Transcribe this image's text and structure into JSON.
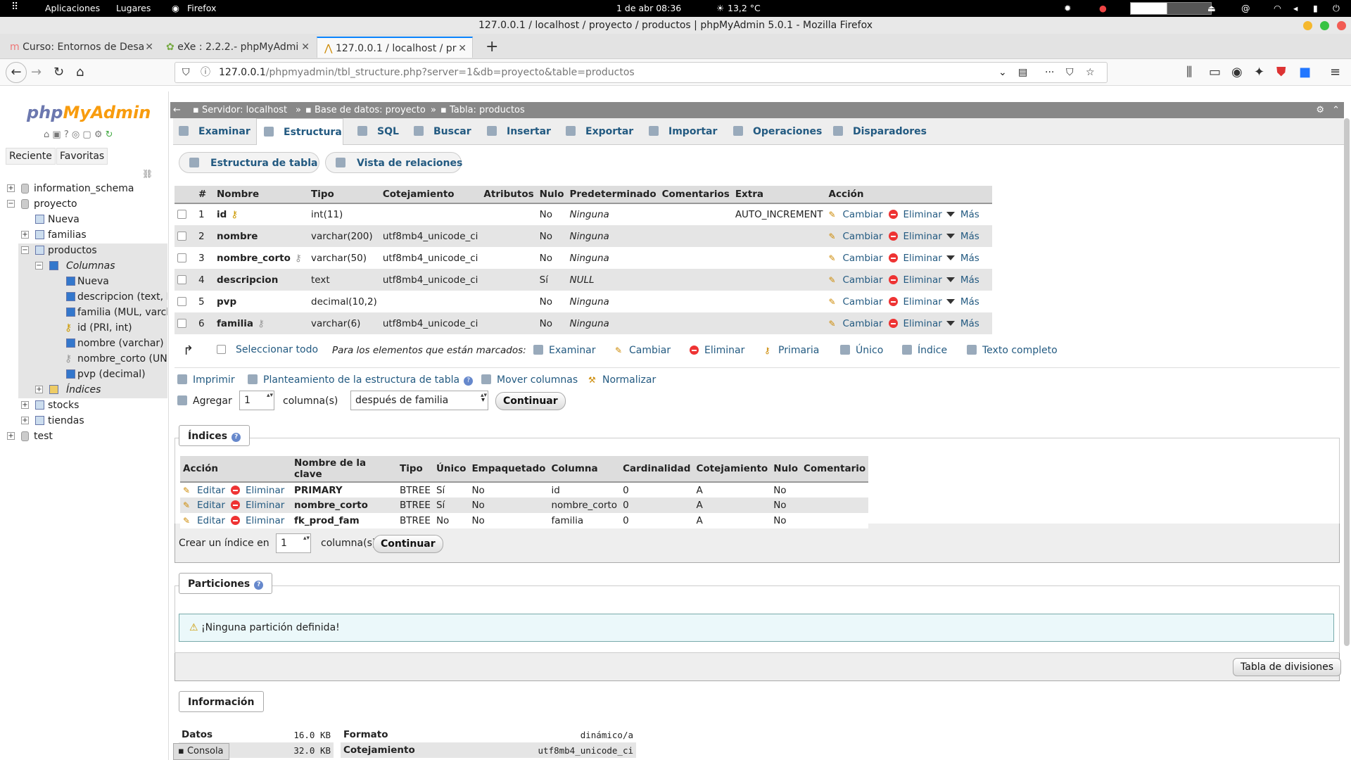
{
  "system": {
    "activities": "Aplicaciones",
    "places": "Lugares",
    "app": "Firefox",
    "clock": "1 de abr  08:36",
    "weather": "13,2 °C"
  },
  "window": {
    "title": "127.0.0.1 / localhost / proyecto / productos | phpMyAdmin 5.0.1 - Mozilla Firefox"
  },
  "browser_tabs": [
    {
      "label": "Curso: Entornos de Desa"
    },
    {
      "label": "eXe : 2.2.2.- phpMyAdmi"
    },
    {
      "label": "127.0.0.1 / localhost / pr"
    }
  ],
  "url": {
    "host": "127.0.0.1",
    "path": "/phpmyadmin/tbl_structure.php?server=1&db=proyecto&table=productos"
  },
  "sidebar": {
    "logo_php": "php",
    "logo_myadmin": "MyAdmin",
    "recent": "Reciente",
    "favorites": "Favoritas",
    "tree": [
      "information_schema",
      "proyecto",
      "Nueva",
      "familias",
      "productos",
      "Columnas",
      "Nueva",
      "descripcion (text, N",
      "familia (MUL, varcha",
      "id (PRI, int)",
      "nombre (varchar)",
      "nombre_corto (UNI,",
      "pvp (decimal)",
      "Índices",
      "stocks",
      "tiendas",
      "test"
    ]
  },
  "breadcrumb": {
    "server": "Servidor: localhost",
    "db": "Base de datos: proyecto",
    "table": "Tabla: productos"
  },
  "main_tabs": [
    "Examinar",
    "Estructura",
    "SQL",
    "Buscar",
    "Insertar",
    "Exportar",
    "Importar",
    "Operaciones",
    "Disparadores"
  ],
  "sub_tabs": [
    "Estructura de tabla",
    "Vista de relaciones"
  ],
  "structure": {
    "headers": [
      "#",
      "Nombre",
      "Tipo",
      "Cotejamiento",
      "Atributos",
      "Nulo",
      "Predeterminado",
      "Comentarios",
      "Extra",
      "Acción"
    ],
    "rows": [
      {
        "n": "1",
        "name": "id",
        "type": "int(11)",
        "coll": "",
        "attr": "",
        "null": "No",
        "def": "Ninguna",
        "comm": "",
        "extra": "AUTO_INCREMENT"
      },
      {
        "n": "2",
        "name": "nombre",
        "type": "varchar(200)",
        "coll": "utf8mb4_unicode_ci",
        "attr": "",
        "null": "No",
        "def": "Ninguna",
        "comm": "",
        "extra": ""
      },
      {
        "n": "3",
        "name": "nombre_corto",
        "type": "varchar(50)",
        "coll": "utf8mb4_unicode_ci",
        "attr": "",
        "null": "No",
        "def": "Ninguna",
        "comm": "",
        "extra": ""
      },
      {
        "n": "4",
        "name": "descripcion",
        "type": "text",
        "coll": "utf8mb4_unicode_ci",
        "attr": "",
        "null": "Sí",
        "def": "NULL",
        "comm": "",
        "extra": ""
      },
      {
        "n": "5",
        "name": "pvp",
        "type": "decimal(10,2)",
        "coll": "",
        "attr": "",
        "null": "No",
        "def": "Ninguna",
        "comm": "",
        "extra": ""
      },
      {
        "n": "6",
        "name": "familia",
        "type": "varchar(6)",
        "coll": "utf8mb4_unicode_ci",
        "attr": "",
        "null": "No",
        "def": "Ninguna",
        "comm": "",
        "extra": ""
      }
    ],
    "actions": {
      "change": "Cambiar",
      "drop": "Eliminar",
      "more": "Más"
    }
  },
  "bulk": {
    "select_all": "Seleccionar todo",
    "with_selected": "Para los elementos que están marcados:",
    "items": [
      "Examinar",
      "Cambiar",
      "Eliminar",
      "Primaria",
      "Único",
      "Índice",
      "Texto completo"
    ]
  },
  "tools": {
    "print": "Imprimir",
    "propose": "Planteamiento de la estructura de tabla",
    "move": "Mover columnas",
    "normalize": "Normalizar"
  },
  "add_col": {
    "label": "Agregar",
    "count": "1",
    "unit": "columna(s)",
    "position": "después de familia",
    "go": "Continuar"
  },
  "indexes": {
    "legend": "Índices",
    "headers": [
      "Acción",
      "Nombre de la clave",
      "Tipo",
      "Único",
      "Empaquetado",
      "Columna",
      "Cardinalidad",
      "Cotejamiento",
      "Nulo",
      "Comentario"
    ],
    "rows": [
      {
        "key": "PRIMARY",
        "type": "BTREE",
        "unique": "Sí",
        "packed": "No",
        "col": "id",
        "card": "0",
        "coll": "A",
        "null": "No",
        "comment": ""
      },
      {
        "key": "nombre_corto",
        "type": "BTREE",
        "unique": "Sí",
        "packed": "No",
        "col": "nombre_corto",
        "card": "0",
        "coll": "A",
        "null": "No",
        "comment": ""
      },
      {
        "key": "fk_prod_fam",
        "type": "BTREE",
        "unique": "No",
        "packed": "No",
        "col": "familia",
        "card": "0",
        "coll": "A",
        "null": "No",
        "comment": ""
      }
    ],
    "edit": "Editar",
    "drop": "Eliminar",
    "create_label": "Crear un índice en",
    "create_count": "1",
    "create_unit": "columna(s)",
    "go": "Continuar"
  },
  "partitions": {
    "legend": "Particiones",
    "notice": "¡Ninguna partición definida!",
    "button": "Tabla de divisiones"
  },
  "info": {
    "legend": "Información",
    "left": [
      {
        "k": "Datos",
        "v": "16.0 KB"
      },
      {
        "k": "",
        "v": "32.0 KB"
      }
    ],
    "right": [
      {
        "k": "Formato",
        "v": "dinámico/a"
      },
      {
        "k": "Cotejamiento",
        "v": "utf8mb4_unicode_ci"
      }
    ]
  },
  "console": "Consola"
}
